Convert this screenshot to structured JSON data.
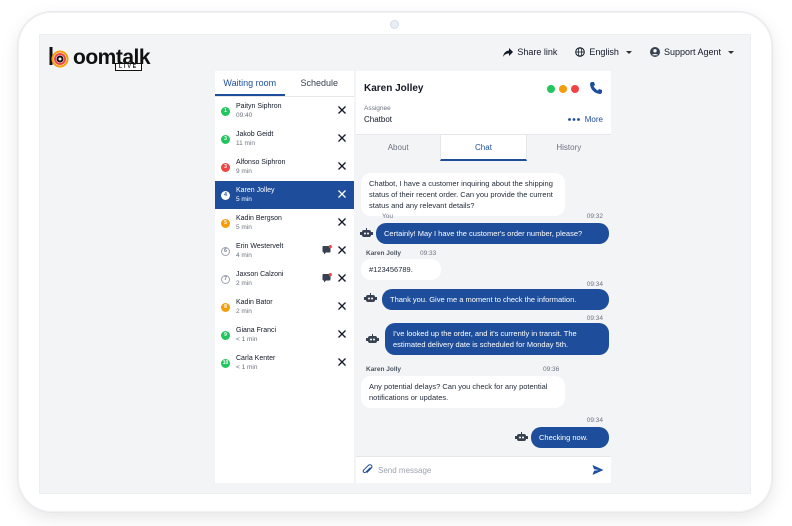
{
  "brand": {
    "logo_word": "oomtalk",
    "logo_sub": "LIVE",
    "accent": "#1e4e9b"
  },
  "header": {
    "share_label": "Share link",
    "language_label": "English",
    "agent_label": "Support Agent"
  },
  "queue": {
    "tabs": [
      {
        "label": "Waiting room",
        "active": true
      },
      {
        "label": "Schedule",
        "active": false
      }
    ],
    "items": [
      {
        "num": "1",
        "name": "Paityn Siphron",
        "time": "09:40",
        "color": "#22c55e",
        "flag": false,
        "selected": false
      },
      {
        "num": "3",
        "name": "Jakob Geidt",
        "time": "11 min",
        "color": "#22c55e",
        "flag": false,
        "selected": false
      },
      {
        "num": "3",
        "name": "Alfonso Siphron",
        "time": "9 min",
        "color": "#ef4444",
        "flag": false,
        "selected": false
      },
      {
        "num": "4",
        "name": "Karen Jolley",
        "time": "5 min",
        "color": "#ffffff",
        "flag": false,
        "selected": true
      },
      {
        "num": "5",
        "name": "Kadin Bergson",
        "time": "5 min",
        "color": "#f59e0b",
        "flag": false,
        "selected": false
      },
      {
        "num": "6",
        "name": "Erin Westervelt",
        "time": "4 min",
        "color": "#ffffff",
        "flag": true,
        "selected": false
      },
      {
        "num": "7",
        "name": "Jaxson Calzoni",
        "time": "2 min",
        "color": "#ffffff",
        "flag": true,
        "selected": false
      },
      {
        "num": "8",
        "name": "Kadin Bator",
        "time": "2 min",
        "color": "#f59e0b",
        "flag": false,
        "selected": false
      },
      {
        "num": "9",
        "name": "Giana Franci",
        "time": "< 1 min",
        "color": "#22c55e",
        "flag": false,
        "selected": false
      },
      {
        "num": "10",
        "name": "Carla Kenter",
        "time": "< 1 min",
        "color": "#22c55e",
        "flag": false,
        "selected": false
      }
    ]
  },
  "contact": {
    "name": "Karen Jolley",
    "status_colors": [
      "#22c55e",
      "#f59e0b",
      "#ef4444"
    ],
    "assignee_label": "Assignee",
    "assignee_value": "Chatbot",
    "more_label": "More"
  },
  "conv_tabs": [
    {
      "label": "About",
      "active": false
    },
    {
      "label": "Chat",
      "active": true
    },
    {
      "label": "History",
      "active": false
    }
  ],
  "chat": {
    "m1": "Chatbot, I have a customer inquiring about the shipping status of their recent order. Can you provide the current status and any relevant details?",
    "m2_sender": "You",
    "m2_time": "09:32",
    "m2": "Certainly! May I have the customer's order number, please?",
    "m3_sender": "Karen Jolly",
    "m3_time": "09:33",
    "m3": "#123456789.",
    "m4_time": "09:34",
    "m4": "Thank you. Give me a moment to check the information.",
    "m5_time": "09:34",
    "m5": "I've looked up the order, and it's currently in transit. The estimated delivery date is scheduled for Monday 5th.",
    "m6_sender": "Karen Jolly",
    "m6_time": "09:36",
    "m6": "Any potential delays? Can you check for any potential notifications or updates.",
    "m7_time": "09:34",
    "m7": "Checking now."
  },
  "composer": {
    "placeholder": "Send message"
  }
}
